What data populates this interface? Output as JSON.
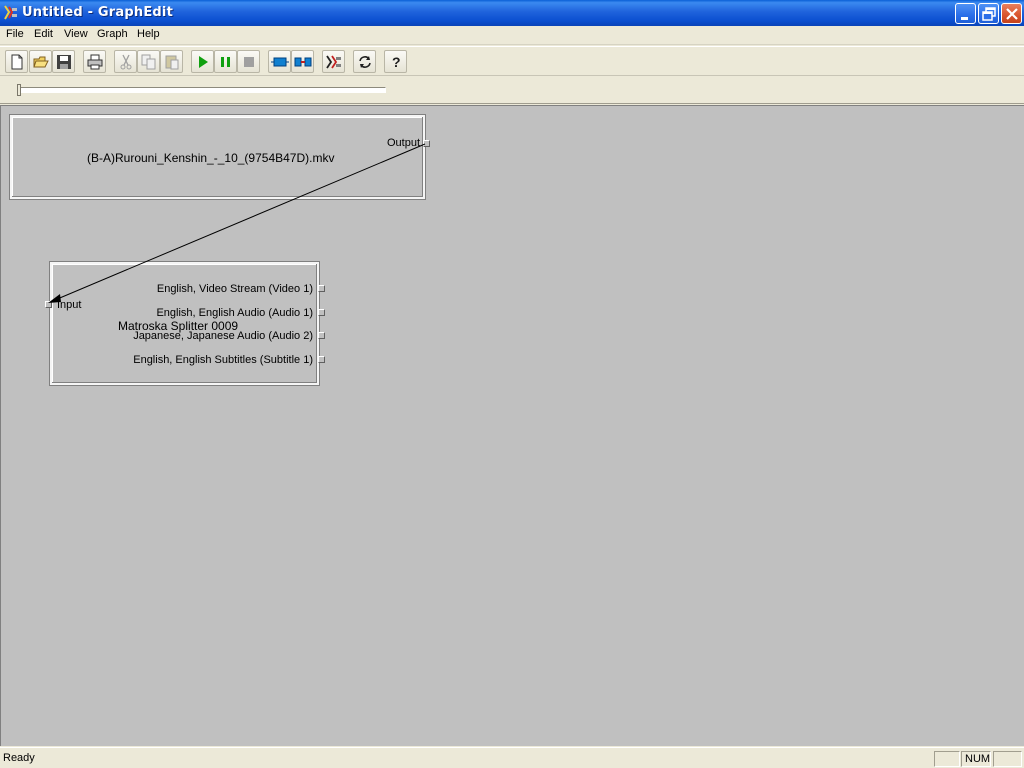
{
  "window": {
    "title": "Untitled - GraphEdit",
    "app_icon": "graphedit-app-icon"
  },
  "menu": {
    "items": [
      {
        "label": "File"
      },
      {
        "label": "Edit"
      },
      {
        "label": "View"
      },
      {
        "label": "Graph"
      },
      {
        "label": "Help"
      }
    ]
  },
  "toolbar": {
    "buttons": [
      {
        "icon": "new-file-icon"
      },
      {
        "icon": "open-folder-icon"
      },
      {
        "icon": "save-icon"
      },
      {
        "icon": "print-icon"
      },
      {
        "icon": "cut-icon",
        "disabled": true
      },
      {
        "icon": "copy-icon",
        "disabled": true
      },
      {
        "icon": "paste-icon",
        "disabled": true
      },
      {
        "icon": "play-icon"
      },
      {
        "icon": "pause-icon"
      },
      {
        "icon": "stop-icon",
        "disabled": true
      },
      {
        "icon": "seek-to-start-icon"
      },
      {
        "icon": "frame-step-icon"
      },
      {
        "icon": "sync-to-clock-icon"
      },
      {
        "icon": "refresh-icon"
      },
      {
        "icon": "help-icon"
      }
    ],
    "colors": {
      "play": "#10a010",
      "pause": "#10a010"
    }
  },
  "seek": {
    "position": 0
  },
  "graph": {
    "source_filter": {
      "name": "(B-A)Rurouni_Kenshin_-_10_(9754B47D).mkv",
      "output_pin": "Output"
    },
    "splitter_filter": {
      "name": "Matroska Splitter 0009",
      "input_pin": "Input",
      "output_pins": [
        {
          "label": "English, Video Stream (Video 1)"
        },
        {
          "label": "English, English Audio (Audio 1)"
        },
        {
          "label": "Japanese, Japanese Audio (Audio 2)"
        },
        {
          "label": "English, English Subtitles (Subtitle 1)"
        }
      ]
    },
    "connections": [
      {
        "from": "Output",
        "to": "Input"
      }
    ],
    "canvas_color": "#c0c0c0"
  },
  "status": {
    "text": "Ready",
    "num_indicator": "NUM"
  }
}
